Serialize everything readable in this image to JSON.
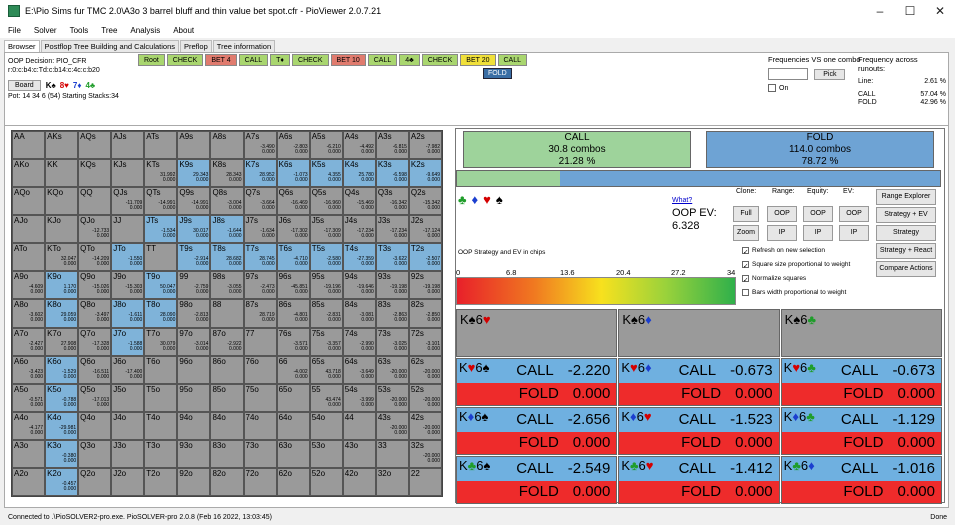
{
  "window": {
    "title": "E:\\Pio Sims fur TMC 2.0\\A3o 3 barrel bluff and thin value bet spot.cfr - PioViewer 2.0.7.21",
    "minimize": "–",
    "maximize": "☐",
    "close": "✕"
  },
  "menu": [
    "File",
    "Solver",
    "Tools",
    "Tree",
    "Analysis",
    "About"
  ],
  "tabs": [
    "Browser",
    "Postflop Tree Building and Calculations",
    "Preflop",
    "Tree information"
  ],
  "info": {
    "decision": "OOP Decision:  PIO_CFR",
    "path": "r:0:c:b4:c:Td:c:b14:c:4c:c:b20",
    "board_button": "Board",
    "board_cards": [
      "K♠",
      "8♥",
      "7♦",
      "4♣"
    ],
    "pot": "Pot: 14 34 6 (54) Starting Stacks:34"
  },
  "path_buttons": [
    {
      "label": "Root",
      "color": "#a9d66f"
    },
    {
      "label": "CHECK",
      "color": "#a9d66f"
    },
    {
      "label": "BET 4",
      "color": "#e07b6e"
    },
    {
      "label": "CALL",
      "color": "#a9d66f"
    },
    {
      "label": "T♦",
      "color": "#a9d66f"
    },
    {
      "label": "CHECK",
      "color": "#a9d66f"
    },
    {
      "label": "BET 10",
      "color": "#e07b6e"
    },
    {
      "label": "CALL",
      "color": "#a9d66f"
    },
    {
      "label": "4♣",
      "color": "#a9d66f"
    },
    {
      "label": "CHECK",
      "color": "#a9d66f"
    },
    {
      "label": "BET 20",
      "color": "#f0e03a"
    },
    {
      "label": "CALL",
      "color": "#a9d66f"
    }
  ],
  "fold_button": "FOLD",
  "freq": {
    "title": "Frequencies VS one combo",
    "pick": "Pick",
    "on": "On"
  },
  "runouts": {
    "title": "Frequency across runouts:",
    "rows": [
      [
        "Line:",
        "2.61 %"
      ],
      [
        "CALL",
        "57.04 %"
      ],
      [
        "FOLD",
        "42.96 %"
      ]
    ]
  },
  "hands": [
    [
      "AA",
      "AKs",
      "AQs",
      "AJs",
      "ATs",
      "A9s",
      "A8s",
      "A7s",
      "A6s",
      "A5s",
      "A4s",
      "A3s",
      "A2s"
    ],
    [
      "AKo",
      "KK",
      "KQs",
      "KJs",
      "KTs",
      "K9s",
      "K8s",
      "K7s",
      "K6s",
      "K5s",
      "K4s",
      "K3s",
      "K2s"
    ],
    [
      "AQo",
      "KQo",
      "QQ",
      "QJs",
      "QTs",
      "Q9s",
      "Q8s",
      "Q7s",
      "Q6s",
      "Q5s",
      "Q4s",
      "Q3s",
      "Q2s"
    ],
    [
      "AJo",
      "KJo",
      "QJo",
      "JJ",
      "JTs",
      "J9s",
      "J8s",
      "J7s",
      "J6s",
      "J5s",
      "J4s",
      "J3s",
      "J2s"
    ],
    [
      "ATo",
      "KTo",
      "QTo",
      "JTo",
      "TT",
      "T9s",
      "T8s",
      "T7s",
      "T6s",
      "T5s",
      "T4s",
      "T3s",
      "T2s"
    ],
    [
      "A9o",
      "K9o",
      "Q9o",
      "J9o",
      "T9o",
      "99",
      "98s",
      "97s",
      "96s",
      "95s",
      "94s",
      "93s",
      "92s"
    ],
    [
      "A8o",
      "K8o",
      "Q8o",
      "J8o",
      "T8o",
      "98o",
      "88",
      "87s",
      "86s",
      "85s",
      "84s",
      "83s",
      "82s"
    ],
    [
      "A7o",
      "K7o",
      "Q7o",
      "J7o",
      "T7o",
      "97o",
      "87o",
      "77",
      "76s",
      "75s",
      "74s",
      "73s",
      "72s"
    ],
    [
      "A6o",
      "K6o",
      "Q6o",
      "J6o",
      "T6o",
      "96o",
      "86o",
      "76o",
      "66",
      "65s",
      "64s",
      "63s",
      "62s"
    ],
    [
      "A5o",
      "K5o",
      "Q5o",
      "J5o",
      "T5o",
      "95o",
      "85o",
      "75o",
      "65o",
      "55",
      "54s",
      "53s",
      "52s"
    ],
    [
      "A4o",
      "K4o",
      "Q4o",
      "J4o",
      "T4o",
      "94o",
      "84o",
      "74o",
      "64o",
      "54o",
      "44",
      "43s",
      "42s"
    ],
    [
      "A3o",
      "K3o",
      "Q3o",
      "J3o",
      "T3o",
      "93o",
      "83o",
      "73o",
      "63o",
      "53o",
      "43o",
      "33",
      "32s"
    ],
    [
      "A2o",
      "K2o",
      "Q2o",
      "J2o",
      "T2o",
      "92o",
      "82o",
      "72o",
      "62o",
      "52o",
      "42o",
      "32o",
      "22"
    ]
  ],
  "cell_colors": [
    "GGGGGGGGGGGGG",
    "GGGGGBGBBBBBB",
    "GGGGGGGGGGGGG",
    "GGGGBBBGGGGGG",
    "GGGBGBBBBBBBB",
    "GBGGBGGGGGGGG",
    "GBGBBGGGGGGGG",
    "GGGBGGGGGGGGG",
    "GBGGGGGGGGGGG",
    "GBGGGGGGGGGGG",
    "GBGGGGGGGGGGG",
    "GBGGGGGGGGGGG",
    "GBGGGGGGGGGGG"
  ],
  "cell_evs": {
    "0-7": "-3.490\n0.000",
    "0-8": "-2.803\n0.000",
    "0-9": "-6.210\n0.000",
    "0-10": "-4.492\n0.000",
    "0-11": "-6.815\n0.000",
    "0-12": "-7.982\n0.000",
    "1-4": "31.992\n0.000",
    "1-5": "29.343\n0.000",
    "1-6": "28.343\n0.000",
    "1-7": "28.952\n0.000",
    "1-8": "-1.073\n0.000",
    "1-9": "4.355\n0.000",
    "1-10": "25.780\n0.000",
    "1-11": "-6.598\n0.000",
    "1-12": "-9.649\n0.000",
    "2-3": "-11.709\n0.000",
    "2-4": "-14.991\n0.000",
    "2-5": "-14.991\n0.000",
    "2-6": "-3.004\n0.000",
    "2-7": "-3.664\n0.000",
    "2-8": "-16.469\n0.000",
    "2-9": "-16.960\n0.000",
    "2-10": "-15.469\n0.000",
    "2-11": "-16.342\n0.000",
    "2-12": "-15.342\n0.000",
    "3-2": "-12.733\n0.000",
    "3-4": "-1.534\n0.000",
    "3-5": "30.017\n0.000",
    "3-6": "-1.644\n0.000",
    "3-7": "-1.634\n0.000",
    "3-8": "-17.302\n0.000",
    "3-9": "-17.309\n0.000",
    "3-10": "-17.234\n0.000",
    "3-11": "-17.234\n0.000",
    "3-12": "-17.124\n0.000",
    "4-1": "32.047\n0.000",
    "4-2": "-14.209\n0.000",
    "4-3": "-1.550\n0.000",
    "4-5": "-2.914\n0.000",
    "4-6": "28.682\n0.000",
    "4-7": "28.745\n0.000",
    "4-8": "-4.710\n0.000",
    "4-9": "-2.580\n0.000",
    "4-10": "-27.359\n0.000",
    "4-11": "-3.622\n0.000",
    "4-12": "-2.507\n0.000",
    "5-0": "-4.609\n0.000",
    "5-1": "1.170\n0.000",
    "5-2": "-15.026\n0.000",
    "5-3": "-15.303\n0.000",
    "5-4": "50.047\n0.000",
    "5-5": "-2.759\n0.000",
    "5-6": "-3.055\n0.000",
    "5-7": "-2.473\n0.000",
    "5-8": "-45.851\n0.000",
    "5-9": "-19.196\n0.000",
    "5-10": "-19.646\n0.000",
    "5-11": "-19.198\n0.000",
    "5-12": "-19.198\n0.000",
    "6-0": "-3.602\n0.000",
    "6-1": "29.059\n0.000",
    "6-2": "-3.497\n0.000",
    "6-3": "-1.611\n0.000",
    "6-4": "28.090\n0.000",
    "6-5": "-2.813\n0.000",
    "6-7": "28.719\n0.000",
    "6-8": "-4.801\n0.000",
    "6-9": "-2.831\n0.000",
    "6-10": "-3.081\n0.000",
    "6-11": "-2.863\n0.000",
    "6-12": "-2.850\n0.000",
    "7-0": "-2.427\n0.000",
    "7-1": "27.908\n0.000",
    "7-2": "-17.328\n0.000",
    "7-3": "-1.588\n0.000",
    "7-4": "30.079\n0.000",
    "7-5": "-3.014\n0.000",
    "7-6": "-2.922\n0.000",
    "7-8": "-3.571\n0.000",
    "7-9": "-3.357\n0.000",
    "7-10": "-2.990\n0.000",
    "7-11": "-3.025\n0.000",
    "7-12": "-3.101\n0.000",
    "8-0": "-3.423\n0.000",
    "8-1": "-1.529\n0.000",
    "8-2": "-16.511\n0.000",
    "8-3": "-17.400\n0.000",
    "8-8": "-4.002\n0.000",
    "8-9": "43.718\n0.000",
    "8-10": "-3.649\n0.000",
    "8-11": "-20.000\n0.000",
    "8-12": "-20.000\n0.000",
    "9-0": "-0.571\n0.000",
    "9-1": "-0.788\n0.000",
    "9-2": "-17.013\n0.000",
    "9-9": "43.474\n0.000",
    "9-10": "-3.999\n0.000",
    "9-11": "-20.000\n0.000",
    "9-12": "-20.000\n0.000",
    "10-0": "-4.177\n0.000",
    "10-1": "-29.981\n0.000",
    "10-11": "-20.000\n0.000",
    "10-12": "-20.000\n0.000",
    "11-1": "-0.380\n0.000",
    "11-12": "-20.000\n0.000",
    "12-1": "-0.457\n0.000"
  },
  "strategy": {
    "call": {
      "label": "CALL",
      "combos": "30.8 combos",
      "pct": "21.28 %"
    },
    "fold": {
      "label": "FOLD",
      "combos": "114.0 combos",
      "pct": "78.72 %"
    },
    "bar_call_fraction": 0.2128
  },
  "suits": [
    "♣",
    "♦",
    "♥",
    "♠"
  ],
  "what": "What?",
  "oop_ev_label": "OOP EV:",
  "oop_ev_value": "6.328",
  "controls": {
    "clone": "Clone:",
    "range": "Range:",
    "equity": "Equity:",
    "ev": "EV:",
    "full": "Full",
    "zoom": "Zoom",
    "oop": "OOP",
    "ip": "IP"
  },
  "side_buttons": [
    "Range Explorer",
    "Strategy + EV",
    "Strategy",
    "Strategy + React",
    "Compare Actions"
  ],
  "options": [
    {
      "label": "Refresh on new selection",
      "checked": true
    },
    {
      "label": "Square size proportional to weight",
      "checked": true
    },
    {
      "label": "Normalize squares",
      "checked": true
    },
    {
      "label": "Bars width proportional to weight",
      "checked": false
    }
  ],
  "ev_label": "OOP Strategy and EV in chips",
  "scale": [
    "0",
    "6.8",
    "13.6",
    "20.4",
    "27.2",
    "34"
  ],
  "combo_headers": [
    "K♠6♥",
    "K♠6♦",
    "K♠6♣"
  ],
  "combo_rows": [
    [
      {
        "label": "K♥6♠",
        "call": "-2.220",
        "fold": "0.000"
      },
      {
        "label": "K♥6♦",
        "call": "-0.673",
        "fold": "0.000"
      },
      {
        "label": "K♥6♣",
        "call": "-0.673",
        "fold": "0.000"
      }
    ],
    [
      {
        "label": "K♦6♠",
        "call": "-2.656",
        "fold": "0.000"
      },
      {
        "label": "K♦6♥",
        "call": "-1.523",
        "fold": "0.000"
      },
      {
        "label": "K♦6♣",
        "call": "-1.129",
        "fold": "0.000"
      }
    ],
    [
      {
        "label": "K♣6♠",
        "call": "-2.549",
        "fold": "0.000"
      },
      {
        "label": "K♣6♥",
        "call": "-1.412",
        "fold": "0.000"
      },
      {
        "label": "K♣6♦",
        "call": "-1.016",
        "fold": "0.000"
      }
    ]
  ],
  "action_call": "CALL",
  "action_fold": "FOLD",
  "status": {
    "left": "Connected to .\\PioSOLVER2-pro.exe. PioSOLVER-pro 2.0.8 (Feb 16 2022, 13:03:45)",
    "right": "Done"
  }
}
